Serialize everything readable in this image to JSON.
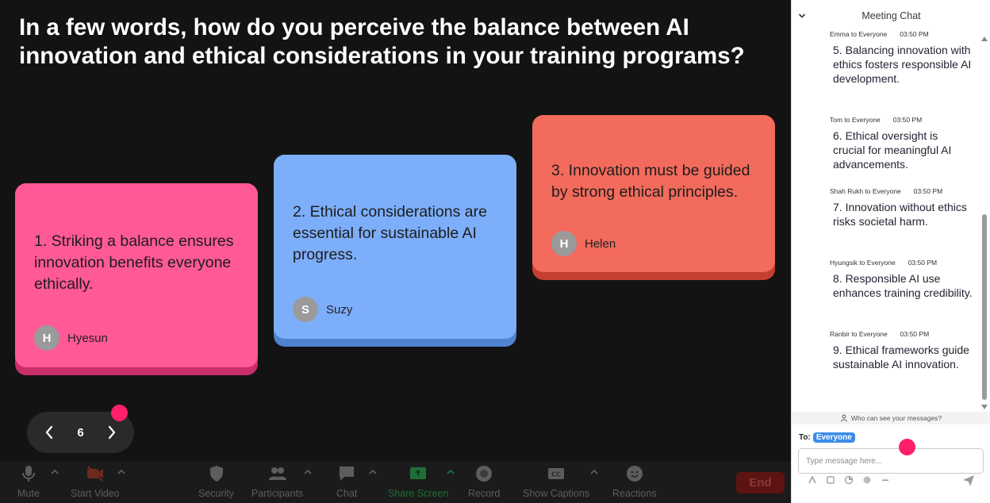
{
  "question": "In a few words, how do you perceive the balance between AI innovation and ethical considerations in your training programs?",
  "cards": [
    {
      "text": "1. Striking a balance ensures innovation benefits everyone ethically.",
      "author": "Hyesun",
      "initial": "H",
      "color": "#ff5997"
    },
    {
      "text": "2. Ethical considerations are essential for sustainable AI progress.",
      "author": "Suzy",
      "initial": "S",
      "color": "#7daefa"
    },
    {
      "text": "3. Innovation must be guided by strong ethical principles.",
      "author": "Helen",
      "initial": "H",
      "color": "#f26b5c"
    }
  ],
  "pager": {
    "page": "6"
  },
  "toolbar": {
    "mute": "Mute",
    "start_video": "Start Video",
    "security": "Security",
    "participants": "Participants",
    "chat": "Chat",
    "share_screen": "Share Screen",
    "record": "Record",
    "show_captions": "Show Captions",
    "reactions": "Reactions",
    "end": "End"
  },
  "chat": {
    "title": "Meeting Chat",
    "messages": [
      {
        "sender": "Emma to Everyone",
        "time": "03:50 PM",
        "text": "5. Balancing innovation with ethics fosters responsible AI development."
      },
      {
        "sender": "Tom to Everyone",
        "time": "03:50 PM",
        "text": "6. Ethical oversight is crucial for meaningful AI advancements."
      },
      {
        "sender": "Shah Rukh to Everyone",
        "time": "03:50 PM",
        "text": "7. Innovation without ethics risks societal harm."
      },
      {
        "sender": "Hyungsik to Everyone",
        "time": "03:50 PM",
        "text": "8. Responsible AI use enhances training credibility."
      },
      {
        "sender": "Ranbir to Everyone",
        "time": "03:50 PM",
        "text": "9. Ethical frameworks guide sustainable AI innovation."
      }
    ],
    "who_can_see": "Who can see your messages?",
    "to_label": "To:",
    "to_value": "Everyone",
    "input_placeholder": "Type message here..."
  },
  "colors": {
    "accent": "#3c8dea",
    "cursor_dot": "#ff1f6b",
    "share_green": "#2fa84f",
    "end_red": "#5e1313"
  }
}
